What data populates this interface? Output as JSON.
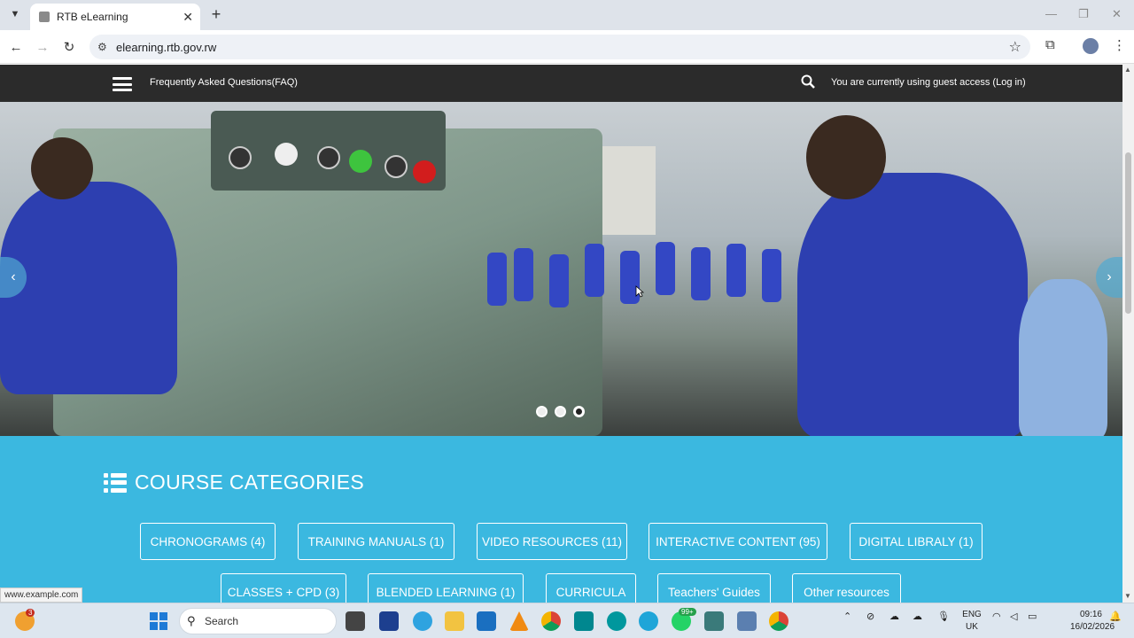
{
  "browser": {
    "tab_title": "RTB eLearning",
    "url": "elearning.rtb.gov.rw",
    "status_url": "www.example.com"
  },
  "navbar": {
    "faq_label": "Frequently Asked Questions(FAQ)",
    "guest_text": "You are currently using guest access (Log in)"
  },
  "carousel": {
    "slide_count": 3,
    "active_index": 2
  },
  "categories": {
    "title": "COURSE CATEGORIES",
    "row1": [
      "CHRONOGRAMS (4)",
      "TRAINING MANUALS (1)",
      "VIDEO RESOURCES (11)",
      "INTERACTIVE CONTENT (95)",
      "DIGITAL LIBRALY (1)"
    ],
    "row2": [
      "CLASSES + CPD (3)",
      "BLENDED LEARNING (1)",
      "CURRICULA",
      "Teachers' Guides",
      "Other resources"
    ]
  },
  "taskbar": {
    "search_label": "Search",
    "notification_badge": "3",
    "whatsapp_badge": "99+",
    "language": "ENG",
    "region": "UK",
    "time": "09:16",
    "date": "16/02/2026"
  },
  "colors": {
    "navbar_bg": "#2b2b2b",
    "categories_bg": "#3bb8e0",
    "taskbar_bg": "#dde6ef"
  }
}
